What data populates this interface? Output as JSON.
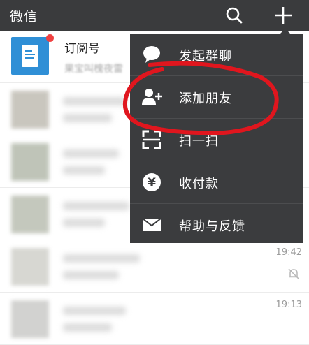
{
  "header": {
    "title": "微信"
  },
  "chats": {
    "subscription": {
      "name": "订阅号",
      "preview": "果宝叫槐夜雷"
    },
    "rows": [
      {
        "time": ""
      },
      {
        "time": ""
      },
      {
        "time": ""
      },
      {
        "time": "19:42",
        "muted": true
      },
      {
        "time": "19:13",
        "muted": false
      }
    ]
  },
  "menu": {
    "items": [
      {
        "label": "发起群聊",
        "icon": "chat-bubble-icon"
      },
      {
        "label": "添加朋友",
        "icon": "add-friend-icon"
      },
      {
        "label": "扫一扫",
        "icon": "scan-icon"
      },
      {
        "label": "收付款",
        "icon": "yen-icon"
      },
      {
        "label": "帮助与反馈",
        "icon": "mail-icon"
      }
    ]
  },
  "colors": {
    "topbar": "#3a3b3d",
    "menu_bg": "#3b3c3e",
    "annotation": "#e0161e",
    "badge": "#f04040"
  }
}
